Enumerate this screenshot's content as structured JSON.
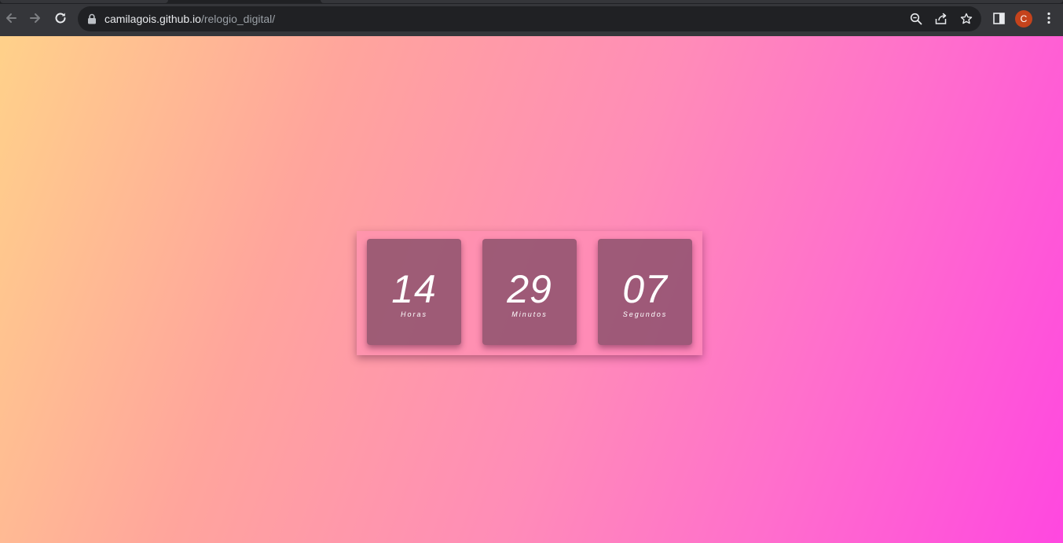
{
  "browser": {
    "url_host": "camilagois.github.io",
    "url_path": "/relogio_digital/",
    "profile_initial": "C",
    "icons": {
      "back": "back-arrow-icon",
      "forward": "forward-arrow-icon",
      "reload": "reload-icon",
      "lock": "lock-icon",
      "zoom": "zoom-out-icon",
      "share": "share-icon",
      "bookmark": "star-icon",
      "side_panel": "side-panel-icon",
      "menu": "kebab-menu-icon"
    },
    "colors": {
      "toolbar": "#35363a",
      "omnibox": "#202124",
      "avatar": "#c5431c"
    }
  },
  "clock": {
    "hours": {
      "value": "14",
      "label": "Horas"
    },
    "minutes": {
      "value": "29",
      "label": "Minutos"
    },
    "seconds": {
      "value": "07",
      "label": "Segundos"
    }
  },
  "theme": {
    "gradient_start": "#ffd18a",
    "gradient_mid": "#ff8cb8",
    "gradient_end": "#ff47e0",
    "card_color": "#78465f"
  }
}
